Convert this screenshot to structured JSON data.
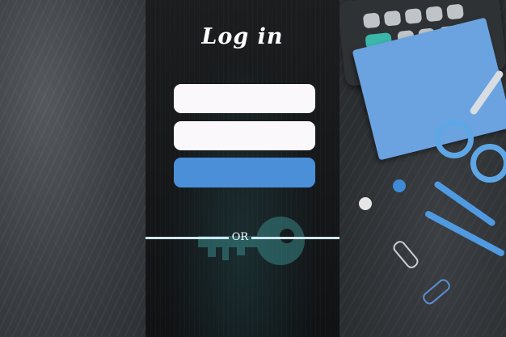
{
  "login": {
    "title": "Log in",
    "username_value": "",
    "password_value": "",
    "submit_label": "",
    "divider_text": "OR"
  },
  "colors": {
    "panel_bg": "#131517",
    "field_bg": "#fbf8fb",
    "submit_bg": "#4a8fd8",
    "divider": "#cfe6ee"
  },
  "icons": {
    "background_key": "key-icon"
  }
}
